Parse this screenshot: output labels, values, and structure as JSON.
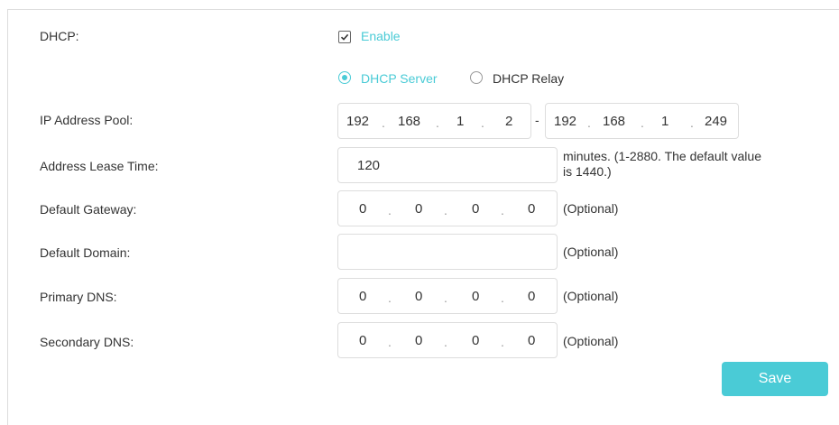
{
  "dhcp": {
    "label": "DHCP:",
    "enable_label": "Enable",
    "enabled": true
  },
  "mode": {
    "options": [
      {
        "label": "DHCP Server",
        "selected": true
      },
      {
        "label": "DHCP Relay",
        "selected": false
      }
    ]
  },
  "ip_pool": {
    "label": "IP Address Pool:",
    "start": [
      "192",
      "168",
      "1",
      "2"
    ],
    "separator": "-",
    "end": [
      "192",
      "168",
      "1",
      "249"
    ]
  },
  "lease_time": {
    "label": "Address Lease Time:",
    "value": "120",
    "note_line1": "minutes. (1-2880. The default value",
    "note_line2": "is 1440.)"
  },
  "default_gateway": {
    "label": "Default Gateway:",
    "octets": [
      "0",
      "0",
      "0",
      "0"
    ],
    "note": "(Optional)"
  },
  "default_domain": {
    "label": "Default Domain:",
    "value": "",
    "note": "(Optional)"
  },
  "primary_dns": {
    "label": "Primary DNS:",
    "octets": [
      "0",
      "0",
      "0",
      "0"
    ],
    "note": "(Optional)"
  },
  "secondary_dns": {
    "label": "Secondary DNS:",
    "octets": [
      "0",
      "0",
      "0",
      "0"
    ],
    "note": "(Optional)"
  },
  "ip_dot": ".",
  "save_label": "Save",
  "colors": {
    "accent": "#4acbd6",
    "text": "#333333",
    "border": "#dddddd"
  }
}
